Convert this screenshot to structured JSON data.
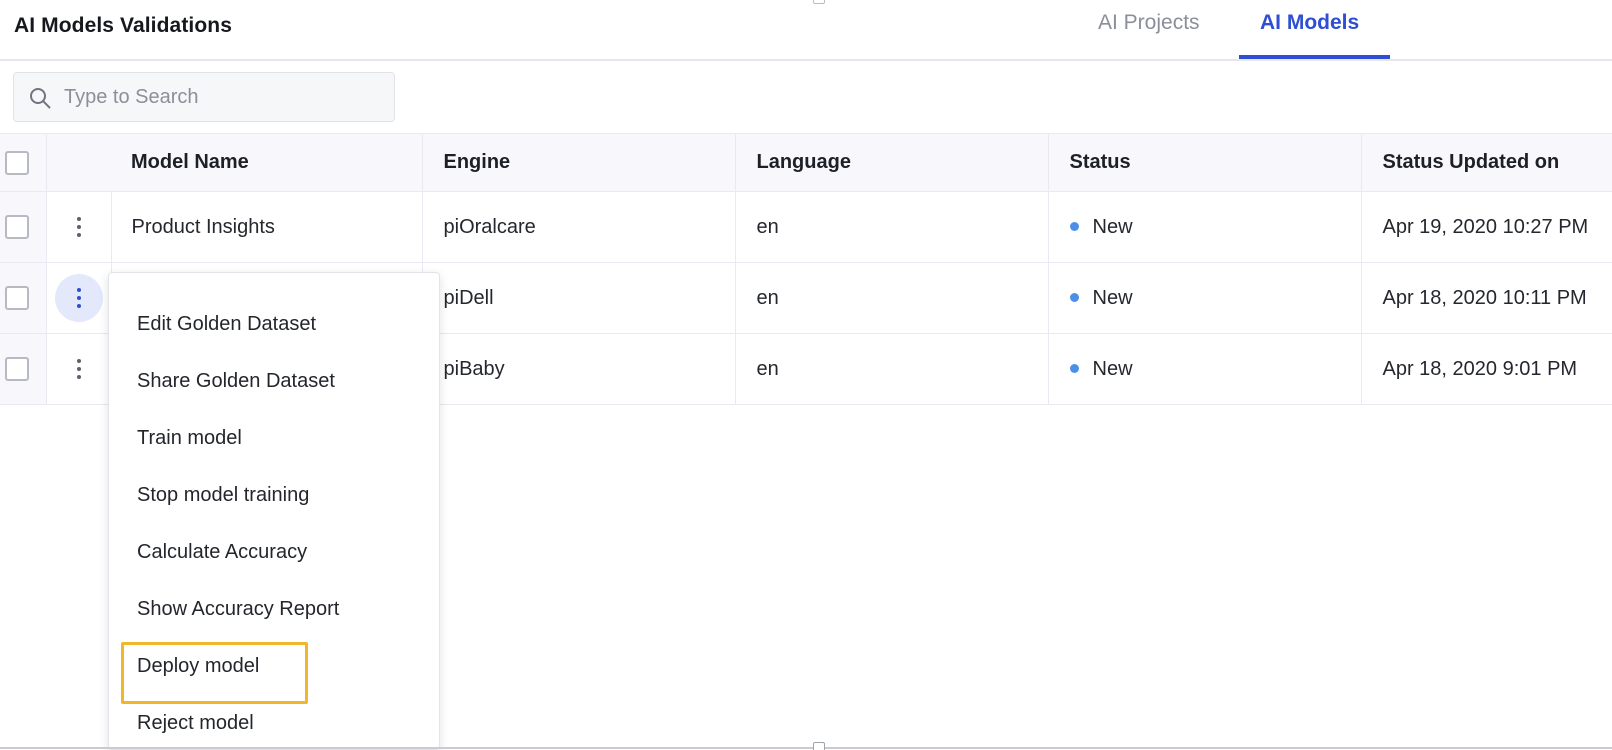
{
  "header": {
    "title": "AI Models Validations",
    "tabs": [
      {
        "label": "AI Projects",
        "active": false
      },
      {
        "label": "AI Models",
        "active": true
      }
    ]
  },
  "search": {
    "placeholder": "Type to Search",
    "value": ""
  },
  "table": {
    "columns": [
      "Model Name",
      "Engine",
      "Language",
      "Status",
      "Status Updated on"
    ],
    "rows": [
      {
        "model_name": "Product Insights",
        "engine": "piOralcare",
        "language": "en",
        "status": "New",
        "updated": "Apr 19, 2020 10:27 PM"
      },
      {
        "model_name": "",
        "engine": "piDell",
        "language": "en",
        "status": "New",
        "updated": "Apr 18, 2020 10:11 PM"
      },
      {
        "model_name": "",
        "engine": "piBaby",
        "language": "en",
        "status": "New",
        "updated": "Apr 18, 2020 9:01 PM"
      }
    ]
  },
  "row_menu": {
    "items": [
      "Edit Golden Dataset",
      "Share Golden Dataset",
      "Train model",
      "Stop model training",
      "Calculate Accuracy",
      "Show Accuracy Report",
      "Deploy model",
      "Reject model"
    ],
    "highlighted_item": "Deploy model"
  },
  "colors": {
    "accent": "#2e4fd3",
    "status_new": "#4a90e8",
    "highlight_outline": "#f2b62b"
  },
  "icons": {
    "search": "search-icon",
    "row_actions": "kebab-menu-icon",
    "status": "status-dot-icon"
  }
}
